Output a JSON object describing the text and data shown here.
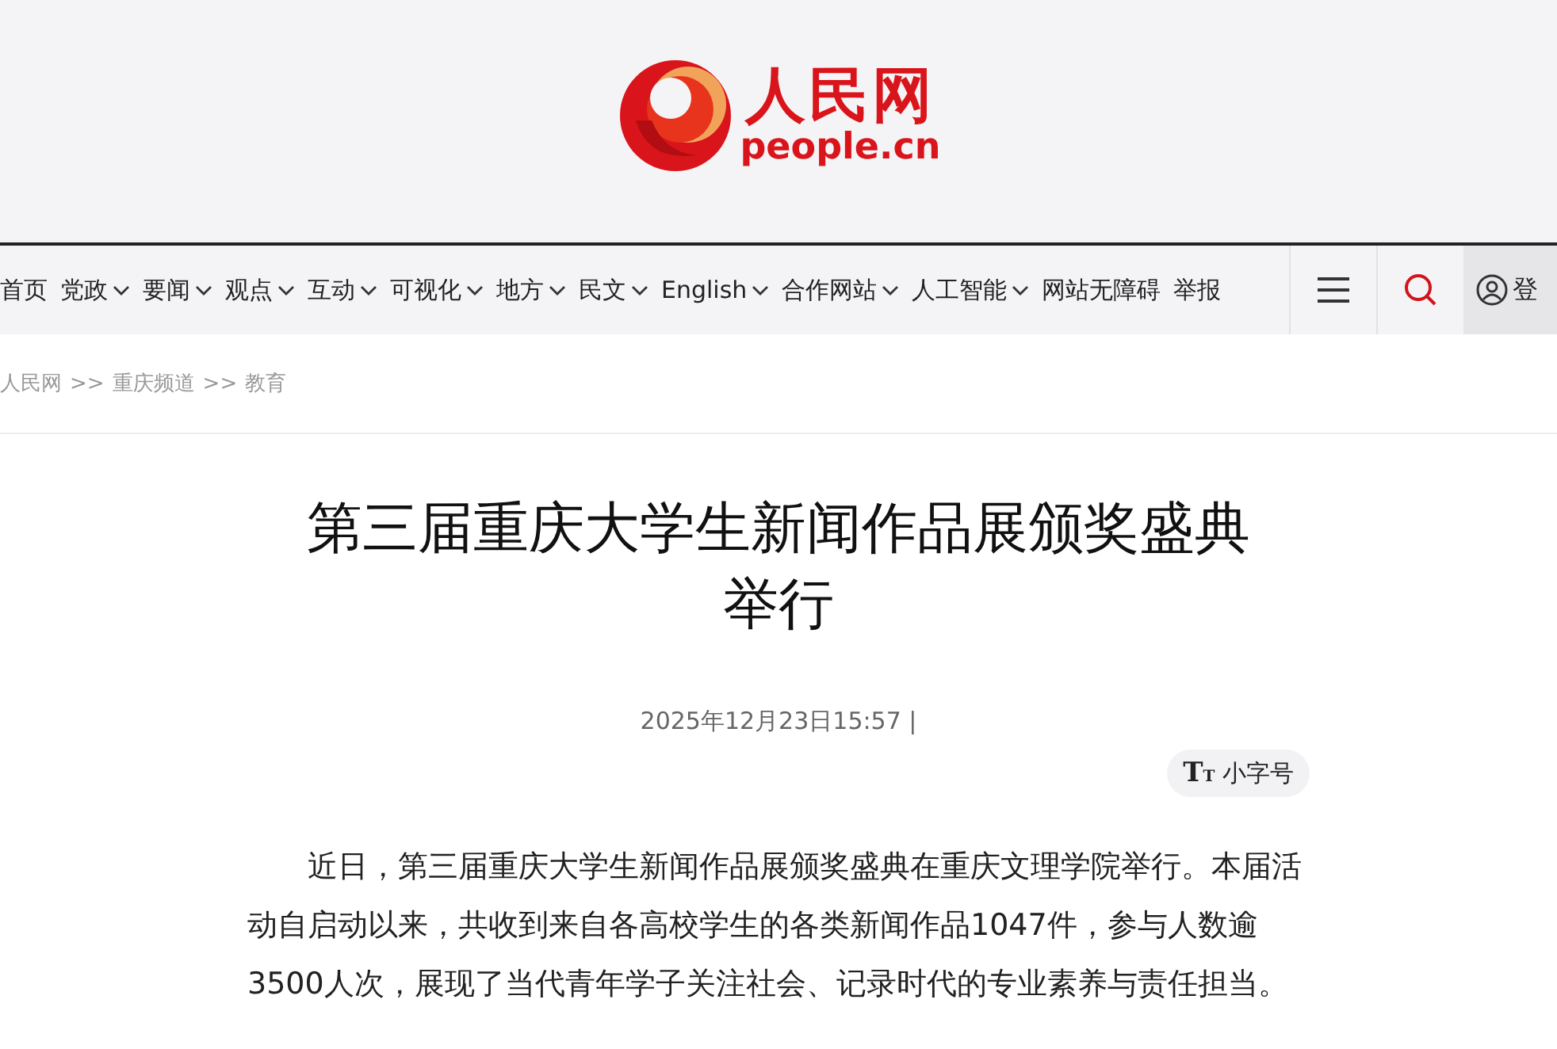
{
  "logo": {
    "name": "人民网",
    "domain": "people.cn"
  },
  "nav": {
    "items": [
      {
        "label": "首页",
        "dropdown": false
      },
      {
        "label": "党政",
        "dropdown": true
      },
      {
        "label": "要闻",
        "dropdown": true
      },
      {
        "label": "观点",
        "dropdown": true
      },
      {
        "label": "互动",
        "dropdown": true
      },
      {
        "label": "可视化",
        "dropdown": true
      },
      {
        "label": "地方",
        "dropdown": true
      },
      {
        "label": "民文",
        "dropdown": true
      },
      {
        "label": "English",
        "dropdown": true
      },
      {
        "label": "合作网站",
        "dropdown": true
      },
      {
        "label": "人工智能",
        "dropdown": true
      },
      {
        "label": "网站无障碍",
        "dropdown": false
      },
      {
        "label": "举报",
        "dropdown": false
      }
    ],
    "login": "登"
  },
  "breadcrumb": [
    {
      "label": "人民网"
    },
    {
      "label": "重庆频道"
    },
    {
      "label": "教育"
    }
  ],
  "breadcrumb_separator": ">>",
  "article": {
    "title": "第三届重庆大学生新闻作品展颁奖盛典举行",
    "date": "2025年12月23日15:57 |",
    "font_button": {
      "icon_big": "T",
      "icon_small": "T",
      "label": "小字号"
    },
    "paragraphs": [
      "近日，第三届重庆大学生新闻作品展颁奖盛典在重庆文理学院举行。本届活动自启动以来，共收到来自各高校学生的各类新闻作品1047件，参与人数逾3500人次，展现了当代青年学子关注社会、记录时代的专业素养与责任担当。"
    ]
  }
}
